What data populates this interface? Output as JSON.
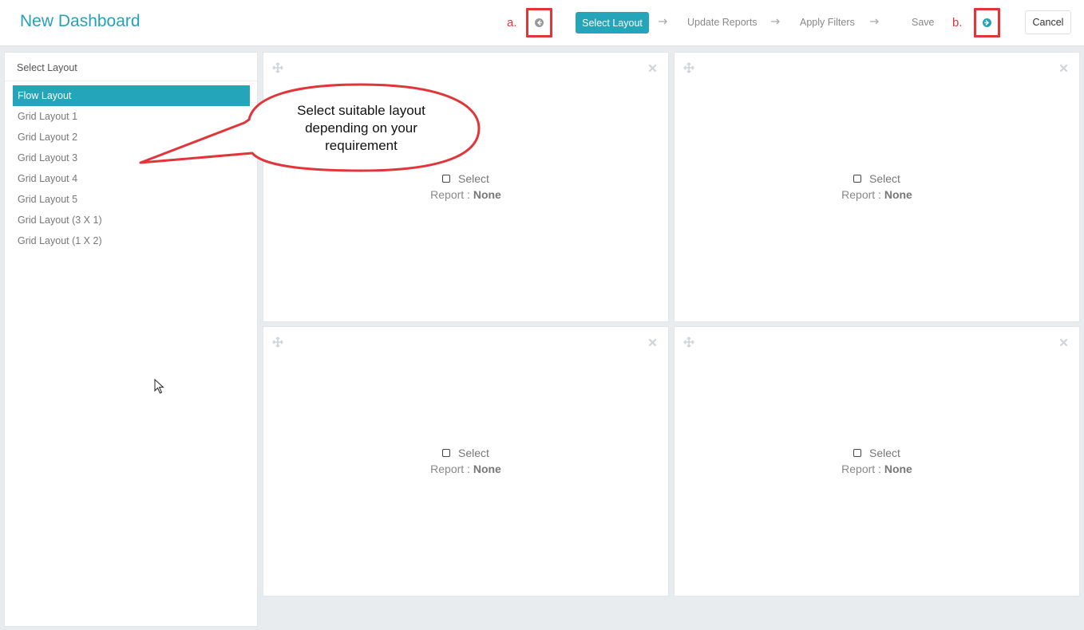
{
  "header": {
    "title": "New Dashboard",
    "annotation_a": "a.",
    "annotation_b": "b.",
    "steps": [
      "Select Layout",
      "Update Reports",
      "Apply Filters",
      "Save"
    ],
    "active_step_index": 0,
    "cancel_label": "Cancel"
  },
  "sidebar": {
    "title": "Select Layout",
    "items": [
      {
        "label": "Flow Layout",
        "active": true
      },
      {
        "label": "Grid Layout 1"
      },
      {
        "label": "Grid Layout 2"
      },
      {
        "label": "Grid Layout 3"
      },
      {
        "label": "Grid Layout 4"
      },
      {
        "label": "Grid Layout 5"
      },
      {
        "label": "Grid Layout (3 X 1)"
      },
      {
        "label": "Grid Layout (1 X 2)"
      }
    ]
  },
  "panels": [
    {
      "select_label": "Select",
      "report_label": "Report :",
      "report_value": "None"
    },
    {
      "select_label": "Select",
      "report_label": "Report :",
      "report_value": "None"
    },
    {
      "select_label": "Select",
      "report_label": "Report :",
      "report_value": "None"
    },
    {
      "select_label": "Select",
      "report_label": "Report :",
      "report_value": "None"
    }
  ],
  "callout": {
    "lines": [
      "Select suitable layout",
      "depending on your",
      "requirement"
    ]
  },
  "colors": {
    "accent": "#24a5ba",
    "title": "#27a1b8",
    "annotation_red": "#e2353a",
    "background": "#e8ecee"
  },
  "icons": {
    "prev": "circle-arrow-left-icon",
    "next": "circle-arrow-right-icon",
    "move": "move-icon",
    "close": "close-icon",
    "step_separator": "arrow-right-icon"
  }
}
